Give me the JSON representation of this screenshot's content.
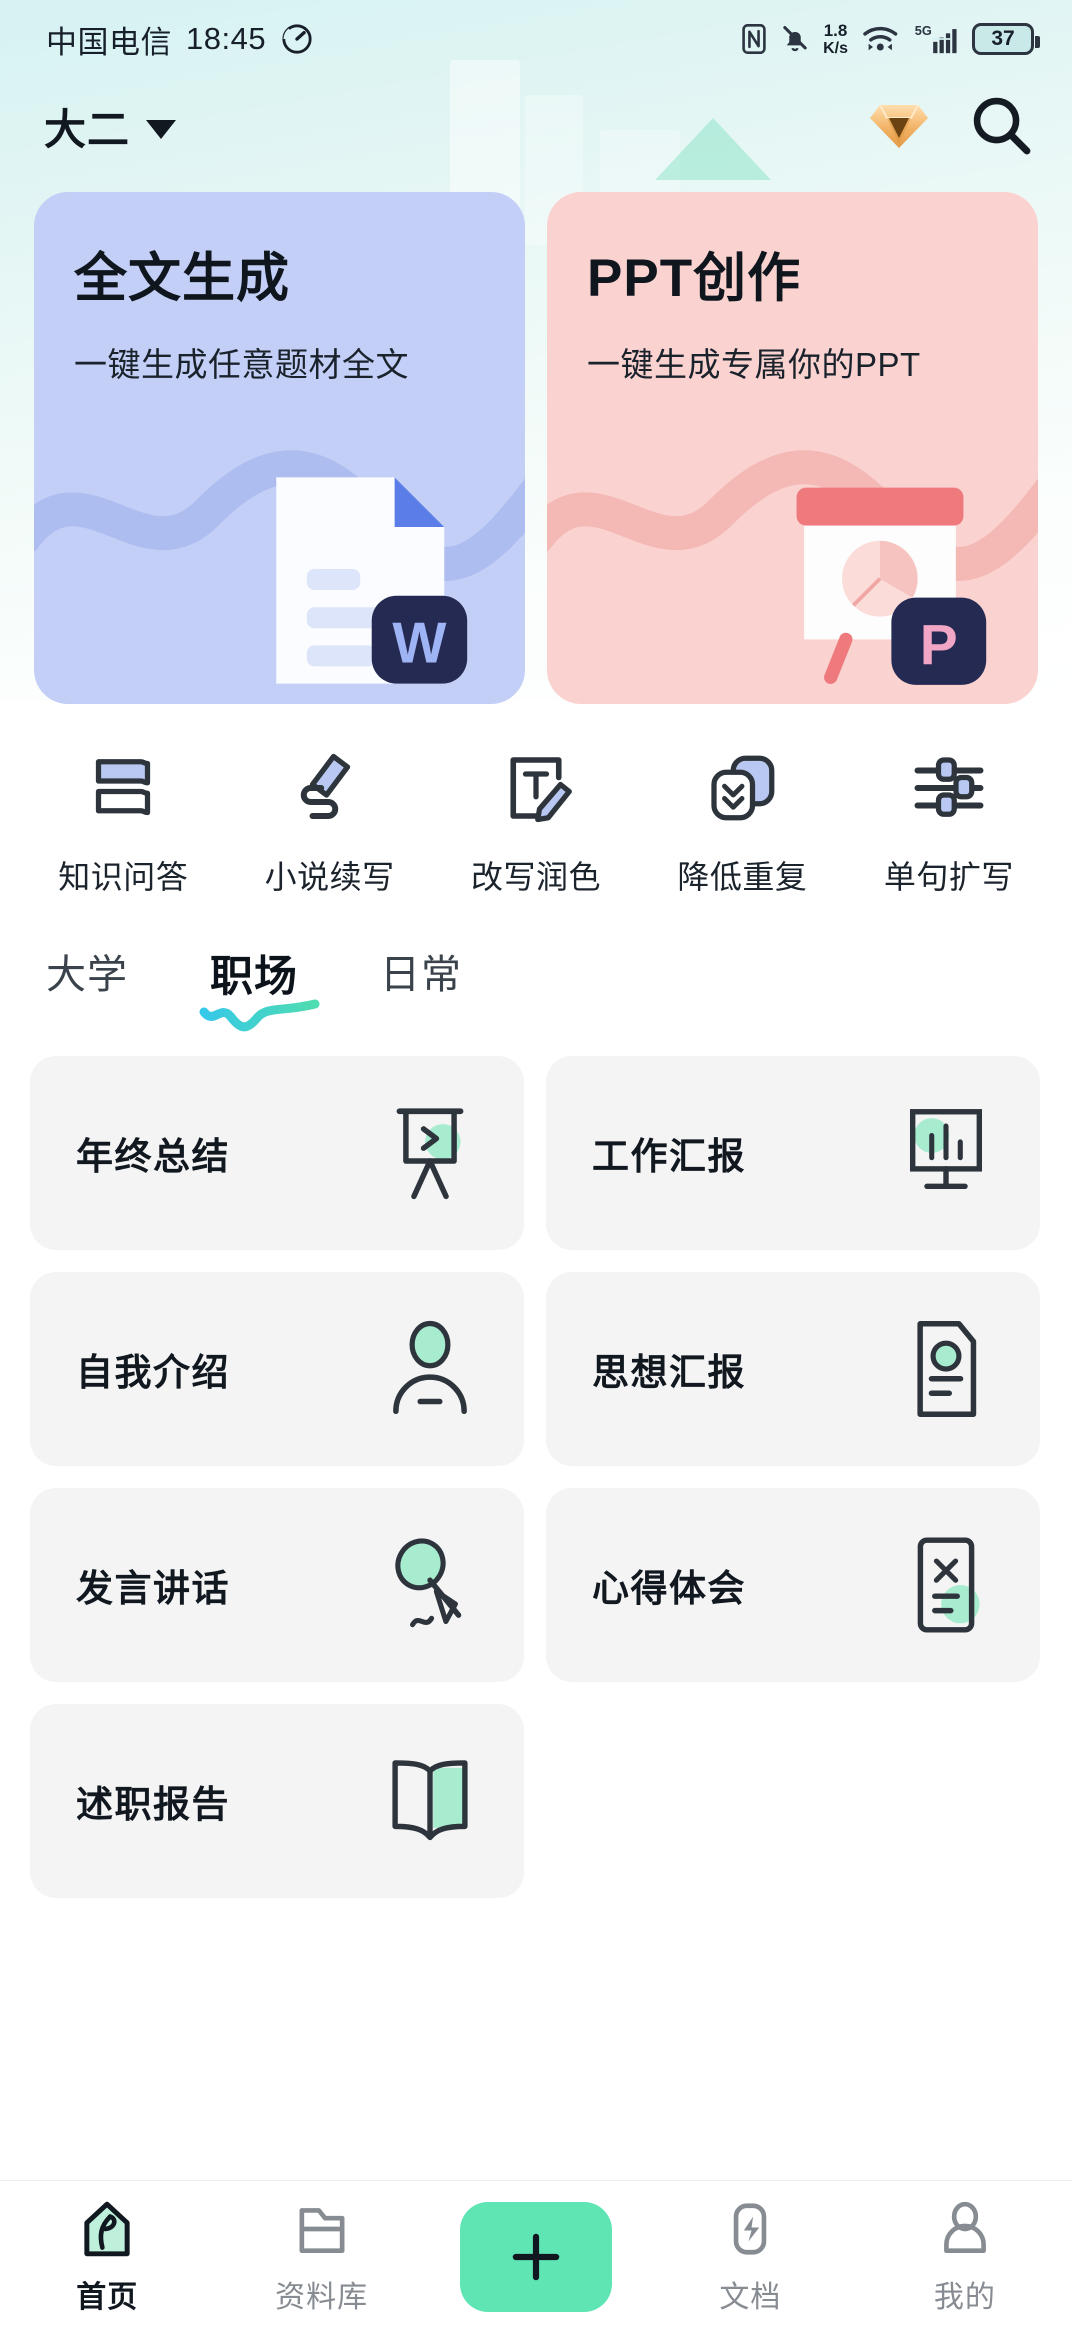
{
  "status_bar": {
    "carrier": "中国电信",
    "time": "18:45",
    "net_speed_value": "1.8",
    "net_speed_unit": "K/s",
    "network_type": "5G",
    "battery": "37",
    "icons": [
      "nfc-icon",
      "mute-bell-icon",
      "wifi-icon",
      "signal-icon",
      "battery-icon"
    ]
  },
  "header": {
    "grade_label": "大二",
    "caret": "chevron-down-icon",
    "vip_badge": "vip-diamond-icon",
    "search": "search-icon"
  },
  "hero_cards": [
    {
      "title": "全文生成",
      "subtitle": "一键生成任意题材全文",
      "bg": "#c3cff6",
      "art": "word-document-icon",
      "badge": "W"
    },
    {
      "title": "PPT创作",
      "subtitle": "一键生成专属你的PPT",
      "bg": "#fad3d1",
      "art": "ppt-slide-icon",
      "badge": "P"
    }
  ],
  "quick_actions": [
    {
      "label": "知识问答",
      "icon": "books-icon"
    },
    {
      "label": "小说续写",
      "icon": "pen-write-icon"
    },
    {
      "label": "改写润色",
      "icon": "text-edit-icon"
    },
    {
      "label": "降低重复",
      "icon": "layers-down-icon"
    },
    {
      "label": "单句扩写",
      "icon": "sliders-icon"
    }
  ],
  "tabs": [
    {
      "label": "大学",
      "active": false
    },
    {
      "label": "职场",
      "active": true
    },
    {
      "label": "日常",
      "active": false
    }
  ],
  "items": [
    {
      "label": "年终总结",
      "icon": "easel-icon"
    },
    {
      "label": "工作汇报",
      "icon": "monitor-chart-icon"
    },
    {
      "label": "自我介绍",
      "icon": "person-icon"
    },
    {
      "label": "思想汇报",
      "icon": "document-report-icon"
    },
    {
      "label": "发言讲话",
      "icon": "microphone-icon"
    },
    {
      "label": "心得体会",
      "icon": "note-x-icon"
    },
    {
      "label": "述职报告",
      "icon": "open-book-icon"
    }
  ],
  "bottom_nav": [
    {
      "label": "首页",
      "icon": "home-pen-icon",
      "active": true
    },
    {
      "label": "资料库",
      "icon": "folder-icon",
      "active": false
    },
    {
      "label": "",
      "icon": "plus-icon",
      "active": false
    },
    {
      "label": "文档",
      "icon": "lightning-doc-icon",
      "active": false
    },
    {
      "label": "我的",
      "icon": "person-outline-icon",
      "active": false
    }
  ],
  "colors": {
    "accent_green": "#5fe5b4",
    "mint": "#a8ecd0",
    "card_blue": "#c3cff6",
    "card_pink": "#fad3d1",
    "vip_gold": "#f0b463"
  }
}
